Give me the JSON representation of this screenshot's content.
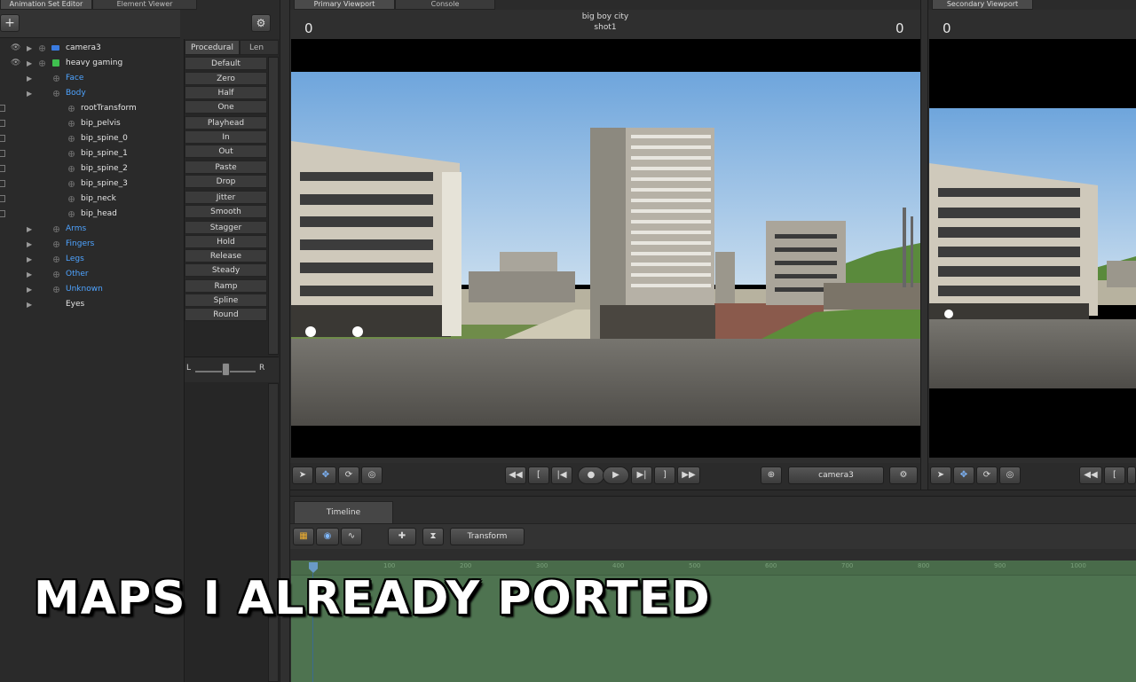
{
  "left_tabs": [
    "Animation Set Editor",
    "Element Viewer"
  ],
  "tree": {
    "items": [
      {
        "label": "camera3",
        "color": "#e4e4e4"
      },
      {
        "label": "heavy gaming",
        "color": "#e4e4e4"
      },
      {
        "label": "Face",
        "color": "#4ea3ff"
      },
      {
        "label": "Body",
        "color": "#4ea3ff"
      },
      {
        "label": "rootTransform",
        "color": "#e4e4e4"
      },
      {
        "label": "bip_pelvis",
        "color": "#e4e4e4"
      },
      {
        "label": "bip_spine_0",
        "color": "#e4e4e4"
      },
      {
        "label": "bip_spine_1",
        "color": "#e4e4e4"
      },
      {
        "label": "bip_spine_2",
        "color": "#e4e4e4"
      },
      {
        "label": "bip_spine_3",
        "color": "#e4e4e4"
      },
      {
        "label": "bip_neck",
        "color": "#e4e4e4"
      },
      {
        "label": "bip_head",
        "color": "#e4e4e4"
      },
      {
        "label": "Arms",
        "color": "#4ea3ff"
      },
      {
        "label": "Fingers",
        "color": "#4ea3ff"
      },
      {
        "label": "Legs",
        "color": "#4ea3ff"
      },
      {
        "label": "Other",
        "color": "#4ea3ff"
      },
      {
        "label": "Unknown",
        "color": "#4ea3ff"
      },
      {
        "label": "Eyes",
        "color": "#e4e4e4"
      }
    ]
  },
  "proc": {
    "tabs": [
      "Procedural",
      "Len"
    ],
    "buttons": [
      "Default",
      "Zero",
      "Half",
      "One",
      "Playhead",
      "In",
      "Out",
      "Paste",
      "Drop",
      "Jitter",
      "Smooth",
      "Stagger",
      "Hold",
      "Release",
      "Steady",
      "Ramp",
      "Spline",
      "Round"
    ],
    "slider_left": "L",
    "slider_right": "R"
  },
  "primary": {
    "tabs": [
      "Primary Viewport",
      "Console"
    ],
    "title": "big boy city",
    "shot": "shot1",
    "left_num": "0",
    "right_num": "0",
    "camera": "camera3"
  },
  "secondary": {
    "tab": "Secondary Viewport",
    "left_num": "0"
  },
  "timeline": {
    "tab": "Timeline",
    "mode": "Transform",
    "ticks": [
      "100",
      "200",
      "300",
      "400",
      "500",
      "600",
      "700",
      "800",
      "900",
      "1000"
    ]
  },
  "caption": "MAPS I ALREADY PORTED"
}
